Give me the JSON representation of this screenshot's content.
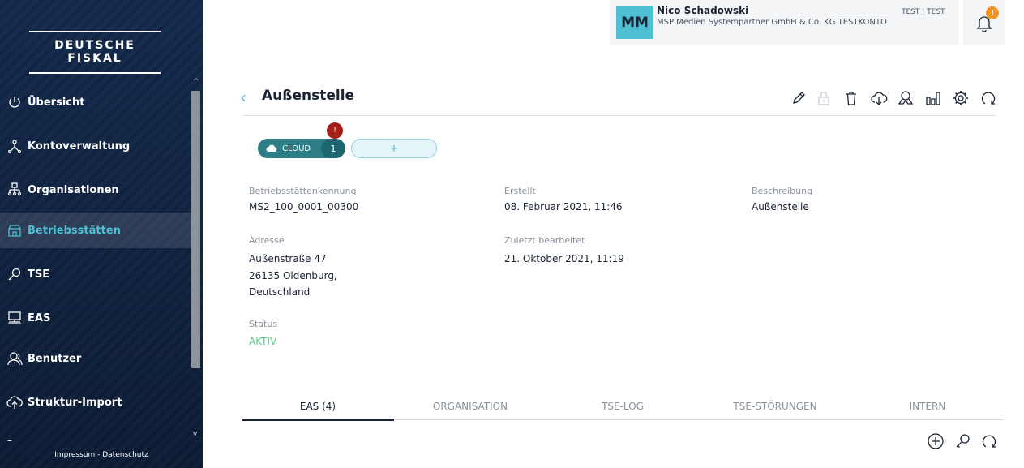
{
  "app": {
    "logo_text": "DEUTSCHE FISKAL"
  },
  "sidebar": {
    "items": [
      {
        "label": "Übersicht",
        "icon": "power-icon"
      },
      {
        "label": "Kontoverwaltung",
        "icon": "account-tree-icon"
      },
      {
        "label": "Organisationen",
        "icon": "org-chart-icon"
      },
      {
        "label": "Betriebsstätten",
        "icon": "store-icon",
        "active": true
      },
      {
        "label": "TSE",
        "icon": "key-icon"
      },
      {
        "label": "EAS",
        "icon": "pos-terminal-icon"
      },
      {
        "label": "Benutzer",
        "icon": "users-icon"
      },
      {
        "label": "Struktur-Import",
        "icon": "cloud-upload-icon"
      }
    ],
    "footer": "Impressum - Datenschutz",
    "footer_dash": "–"
  },
  "header": {
    "avatar_initials": "MM",
    "user_name": "Nico Schadowski",
    "user_company": "MSP Medien Systempartner GmbH & Co. KG TESTKONTO",
    "environment": "TEST | TEST",
    "notification_badge": "!"
  },
  "page": {
    "title": "Außenstelle",
    "back_symbol": "‹"
  },
  "pills": {
    "cloud_label": "CLOUD",
    "cloud_count": "1",
    "cloud_badge": "!",
    "add_label": "+"
  },
  "fields": {
    "id_label": "Betriebsstättenkennung",
    "id_value": "MS2_100_0001_00300",
    "created_label": "Erstellt",
    "created_value": "08. Februar 2021, 11:46",
    "description_label": "Beschreibung",
    "description_value": "Außenstelle",
    "address_label": "Adresse",
    "address_line1": "Außenstraße 47",
    "address_line2": "26135 Oldenburg,",
    "address_line3": "Deutschland",
    "edited_label": "Zuletzt bearbeitet",
    "edited_value": "21. Oktober 2021, 11:19",
    "status_label": "Status",
    "status_value": "AKTIV"
  },
  "tabs": [
    {
      "label": "EAS (4)",
      "active": true
    },
    {
      "label": "ORGANISATION"
    },
    {
      "label": "TSE-LOG"
    },
    {
      "label": "TSE-STÖRUNGEN"
    },
    {
      "label": "INTERN"
    }
  ],
  "colors": {
    "accent": "#4ec0d4",
    "sidebar_bg": "#0d1e36",
    "cloud_pill": "#2c7d86",
    "badge_red": "#a3201a",
    "badge_orange": "#f0942a",
    "status_green": "#5cc98a"
  }
}
